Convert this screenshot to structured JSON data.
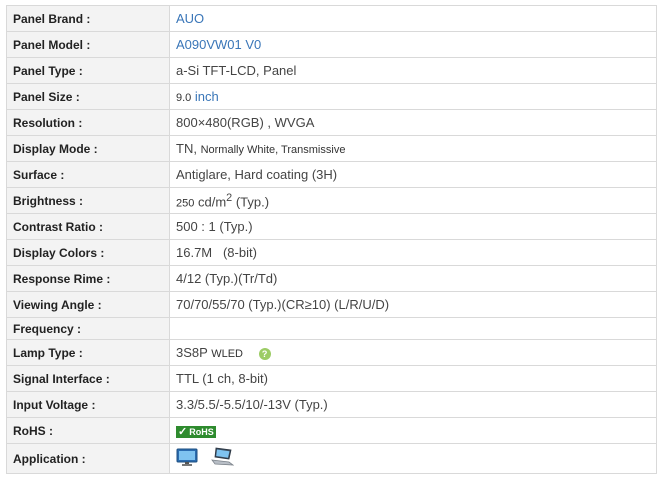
{
  "rows": [
    {
      "label": "Panel Brand :",
      "value": "AUO"
    },
    {
      "label": "Panel Model :",
      "value": "A090VW01 V0"
    },
    {
      "label": "Panel Type :",
      "value": "a-Si TFT-LCD, Panel"
    },
    {
      "label": "Panel Size :",
      "value_num": "9.0",
      "value_unit": "inch"
    },
    {
      "label": "Resolution :",
      "value": "800×480(RGB) , WVGA"
    },
    {
      "label": "Display Mode :",
      "value_main": "TN,",
      "value_small": "Normally White, Transmissive"
    },
    {
      "label": "Surface :",
      "value": "Antiglare, Hard coating (3H)"
    },
    {
      "label": "Brightness :",
      "value_num": "250",
      "value_unit": "cd/m",
      "value_sup": "2",
      "value_suffix": "(Typ.)"
    },
    {
      "label": "Contrast Ratio :",
      "value": "500 : 1 (Typ.)"
    },
    {
      "label": "Display Colors :",
      "value": "16.7M   (8-bit)"
    },
    {
      "label": "Response Rime :",
      "value": "4/12 (Typ.)(Tr/Td)"
    },
    {
      "label": "Viewing Angle :",
      "value": "70/70/55/70 (Typ.)(CR≥10) (L/R/U/D)"
    },
    {
      "label": "Frequency :",
      "value": ""
    },
    {
      "label": "Lamp Type :",
      "value_main": "3S8P",
      "value_small": "WLED",
      "hint_icon": "?"
    },
    {
      "label": "Signal Interface :",
      "value": "TTL (1 ch, 8-bit)"
    },
    {
      "label": "Input Voltage :",
      "value": "3.3/5.5/-5.5/10/-13V (Typ.)"
    },
    {
      "label": "RoHS :",
      "badge_check": "✓",
      "badge_text": "RoHS"
    },
    {
      "label": "Application :",
      "icons": [
        "monitor-icon",
        "laptop-icon"
      ]
    }
  ]
}
